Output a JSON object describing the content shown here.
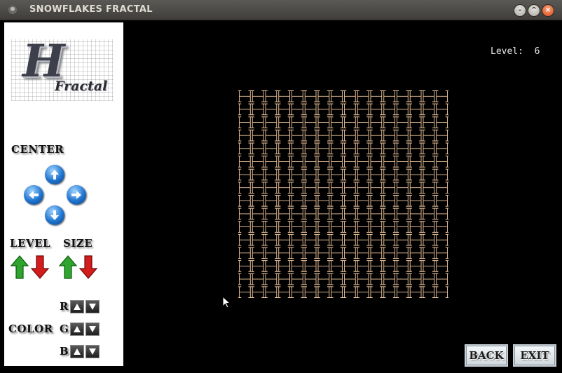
{
  "window": {
    "title": "SNOWFLAKES FRACTAL"
  },
  "logo": {
    "big_letter": "H",
    "subtitle": "Fractal"
  },
  "sidebar": {
    "center_label": "CENTER",
    "level_label": "LEVEL",
    "size_label": "SIZE",
    "color_label": "COLOR",
    "r_label": "R",
    "g_label": "G",
    "b_label": "B"
  },
  "canvas": {
    "level_text": "Level:  6",
    "fractal_color": "#f2c9a0",
    "background": "#000000"
  },
  "buttons": {
    "back": "BACK",
    "exit": "EXIT"
  },
  "colors": {
    "nav_arrow_blue": "#1f74cf",
    "up_green": "#2fa52f",
    "down_red": "#d41c1c"
  }
}
